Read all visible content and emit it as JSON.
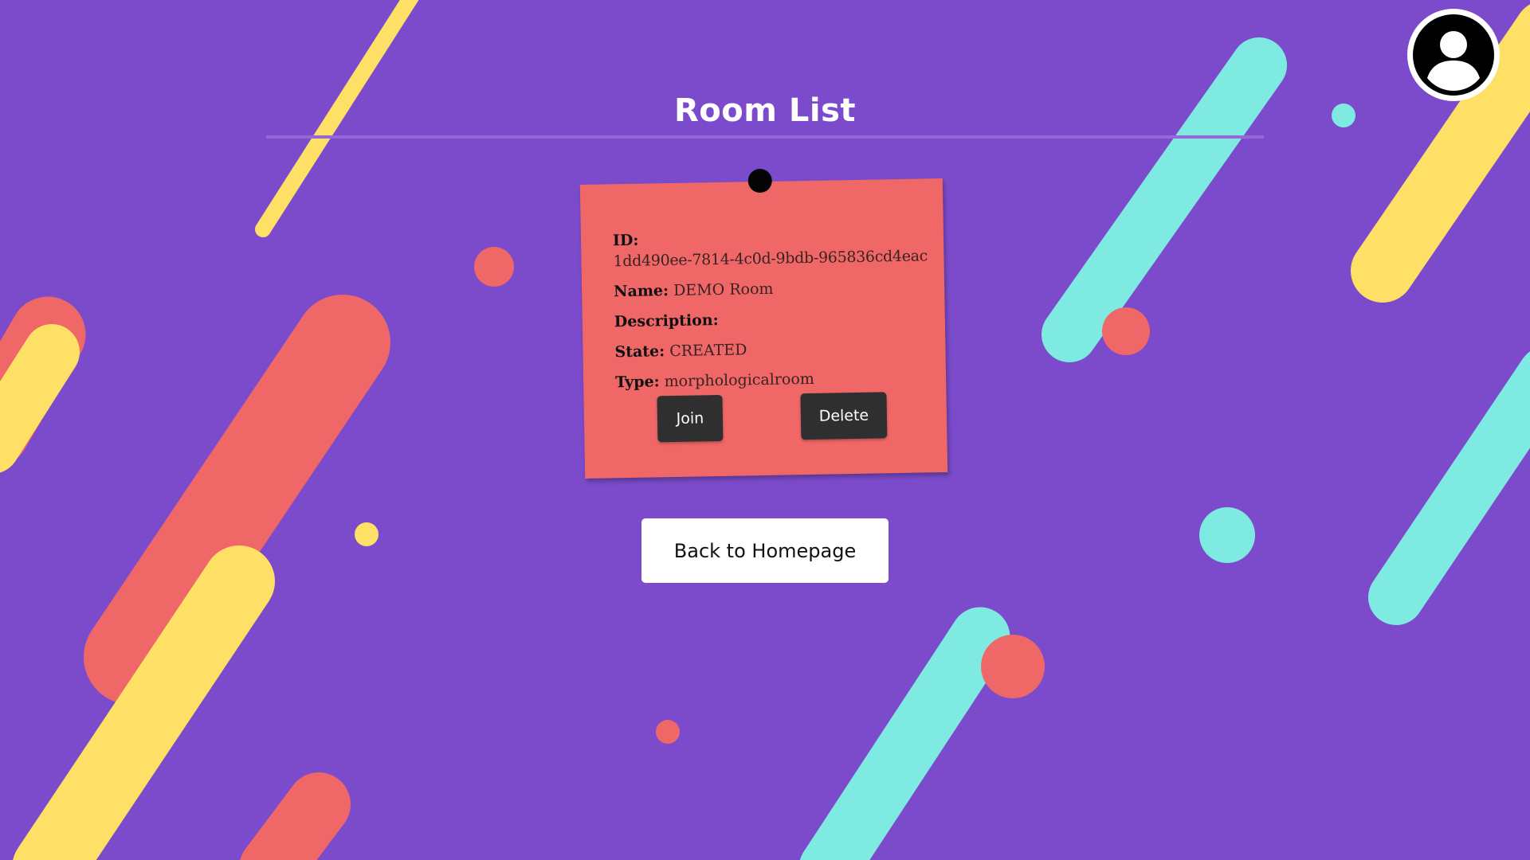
{
  "page": {
    "title": "Room List"
  },
  "profile": {
    "icon": "user-avatar-icon"
  },
  "room_card": {
    "id_label": "ID:",
    "id_value": "1dd490ee-7814-4c0d-9bdb-965836cd4eac",
    "name_label": "Name:",
    "name_value": "DEMO Room",
    "description_label": "Description:",
    "description_value": "",
    "state_label": "State:",
    "state_value": "CREATED",
    "type_label": "Type:",
    "type_value": "morphologicalroom",
    "join_label": "Join",
    "delete_label": "Delete"
  },
  "navigation": {
    "back_label": "Back to Homepage"
  },
  "colors": {
    "background": "#7b4bcb",
    "note": "#ef6767",
    "yellow": "#ffe066",
    "cyan": "#7eeae2",
    "coral": "#ef6767",
    "dark_button": "#2f2f2f"
  }
}
